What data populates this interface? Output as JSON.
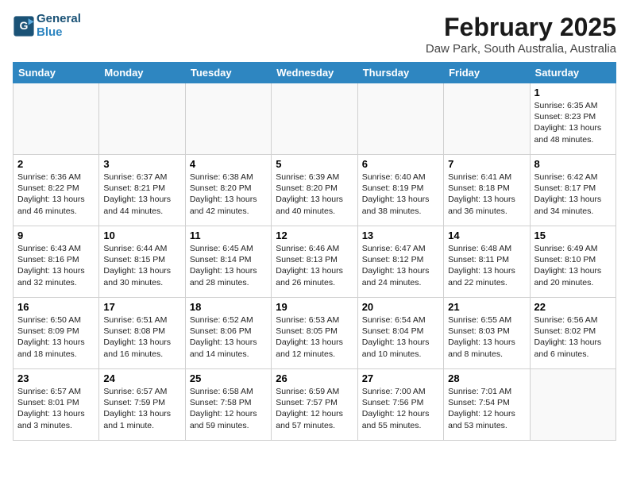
{
  "header": {
    "logo_line1": "General",
    "logo_line2": "Blue",
    "title": "February 2025",
    "subtitle": "Daw Park, South Australia, Australia"
  },
  "weekdays": [
    "Sunday",
    "Monday",
    "Tuesday",
    "Wednesday",
    "Thursday",
    "Friday",
    "Saturday"
  ],
  "weeks": [
    [
      {
        "day": "",
        "info": ""
      },
      {
        "day": "",
        "info": ""
      },
      {
        "day": "",
        "info": ""
      },
      {
        "day": "",
        "info": ""
      },
      {
        "day": "",
        "info": ""
      },
      {
        "day": "",
        "info": ""
      },
      {
        "day": "1",
        "info": "Sunrise: 6:35 AM\nSunset: 8:23 PM\nDaylight: 13 hours\nand 48 minutes."
      }
    ],
    [
      {
        "day": "2",
        "info": "Sunrise: 6:36 AM\nSunset: 8:22 PM\nDaylight: 13 hours\nand 46 minutes."
      },
      {
        "day": "3",
        "info": "Sunrise: 6:37 AM\nSunset: 8:21 PM\nDaylight: 13 hours\nand 44 minutes."
      },
      {
        "day": "4",
        "info": "Sunrise: 6:38 AM\nSunset: 8:20 PM\nDaylight: 13 hours\nand 42 minutes."
      },
      {
        "day": "5",
        "info": "Sunrise: 6:39 AM\nSunset: 8:20 PM\nDaylight: 13 hours\nand 40 minutes."
      },
      {
        "day": "6",
        "info": "Sunrise: 6:40 AM\nSunset: 8:19 PM\nDaylight: 13 hours\nand 38 minutes."
      },
      {
        "day": "7",
        "info": "Sunrise: 6:41 AM\nSunset: 8:18 PM\nDaylight: 13 hours\nand 36 minutes."
      },
      {
        "day": "8",
        "info": "Sunrise: 6:42 AM\nSunset: 8:17 PM\nDaylight: 13 hours\nand 34 minutes."
      }
    ],
    [
      {
        "day": "9",
        "info": "Sunrise: 6:43 AM\nSunset: 8:16 PM\nDaylight: 13 hours\nand 32 minutes."
      },
      {
        "day": "10",
        "info": "Sunrise: 6:44 AM\nSunset: 8:15 PM\nDaylight: 13 hours\nand 30 minutes."
      },
      {
        "day": "11",
        "info": "Sunrise: 6:45 AM\nSunset: 8:14 PM\nDaylight: 13 hours\nand 28 minutes."
      },
      {
        "day": "12",
        "info": "Sunrise: 6:46 AM\nSunset: 8:13 PM\nDaylight: 13 hours\nand 26 minutes."
      },
      {
        "day": "13",
        "info": "Sunrise: 6:47 AM\nSunset: 8:12 PM\nDaylight: 13 hours\nand 24 minutes."
      },
      {
        "day": "14",
        "info": "Sunrise: 6:48 AM\nSunset: 8:11 PM\nDaylight: 13 hours\nand 22 minutes."
      },
      {
        "day": "15",
        "info": "Sunrise: 6:49 AM\nSunset: 8:10 PM\nDaylight: 13 hours\nand 20 minutes."
      }
    ],
    [
      {
        "day": "16",
        "info": "Sunrise: 6:50 AM\nSunset: 8:09 PM\nDaylight: 13 hours\nand 18 minutes."
      },
      {
        "day": "17",
        "info": "Sunrise: 6:51 AM\nSunset: 8:08 PM\nDaylight: 13 hours\nand 16 minutes."
      },
      {
        "day": "18",
        "info": "Sunrise: 6:52 AM\nSunset: 8:06 PM\nDaylight: 13 hours\nand 14 minutes."
      },
      {
        "day": "19",
        "info": "Sunrise: 6:53 AM\nSunset: 8:05 PM\nDaylight: 13 hours\nand 12 minutes."
      },
      {
        "day": "20",
        "info": "Sunrise: 6:54 AM\nSunset: 8:04 PM\nDaylight: 13 hours\nand 10 minutes."
      },
      {
        "day": "21",
        "info": "Sunrise: 6:55 AM\nSunset: 8:03 PM\nDaylight: 13 hours\nand 8 minutes."
      },
      {
        "day": "22",
        "info": "Sunrise: 6:56 AM\nSunset: 8:02 PM\nDaylight: 13 hours\nand 6 minutes."
      }
    ],
    [
      {
        "day": "23",
        "info": "Sunrise: 6:57 AM\nSunset: 8:01 PM\nDaylight: 13 hours\nand 3 minutes."
      },
      {
        "day": "24",
        "info": "Sunrise: 6:57 AM\nSunset: 7:59 PM\nDaylight: 13 hours\nand 1 minute."
      },
      {
        "day": "25",
        "info": "Sunrise: 6:58 AM\nSunset: 7:58 PM\nDaylight: 12 hours\nand 59 minutes."
      },
      {
        "day": "26",
        "info": "Sunrise: 6:59 AM\nSunset: 7:57 PM\nDaylight: 12 hours\nand 57 minutes."
      },
      {
        "day": "27",
        "info": "Sunrise: 7:00 AM\nSunset: 7:56 PM\nDaylight: 12 hours\nand 55 minutes."
      },
      {
        "day": "28",
        "info": "Sunrise: 7:01 AM\nSunset: 7:54 PM\nDaylight: 12 hours\nand 53 minutes."
      },
      {
        "day": "",
        "info": ""
      }
    ]
  ]
}
